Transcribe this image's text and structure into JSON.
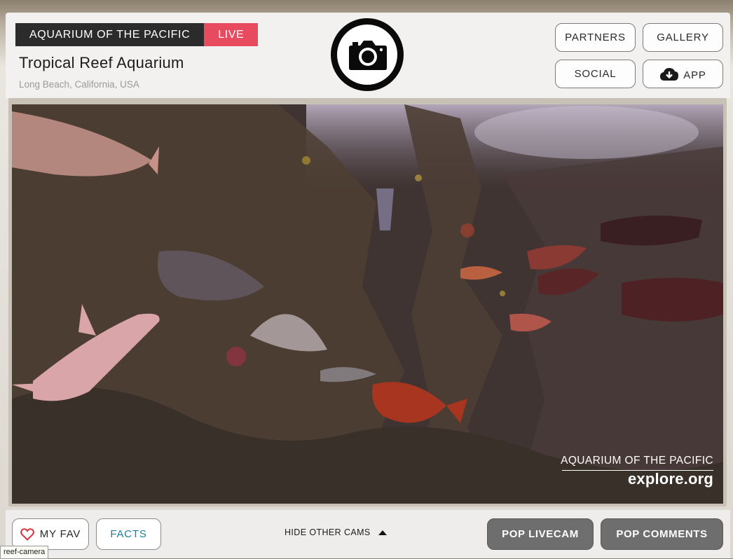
{
  "header": {
    "brand": "AQUARIUM OF THE PACIFIC",
    "live_label": "LIVE",
    "title": "Tropical Reef Aquarium",
    "location": "Long Beach, California, USA",
    "nav": {
      "partners": "PARTNERS",
      "gallery": "GALLERY",
      "social": "SOCIAL",
      "app": "APP"
    }
  },
  "video": {
    "watermark_org": "AQUARIUM OF THE PACIFIC",
    "watermark_site": "explore.org"
  },
  "footer": {
    "my_fav": "MY FAV",
    "facts": "FACTS",
    "hide_other_cams": "HIDE OTHER CAMS",
    "pop_livecam": "POP LIVECAM",
    "pop_comments": "POP COMMENTS"
  },
  "tooltip": "reef-camera",
  "colors": {
    "brand_dark": "#2b2b2b",
    "live_red": "#e84a5f",
    "facts_teal": "#1f7f96",
    "heart_red": "#d8323c",
    "dark_button": "#6e6e6e"
  },
  "icons": [
    "camera-icon",
    "cloud-download-icon",
    "heart-icon",
    "caret-up-icon"
  ]
}
